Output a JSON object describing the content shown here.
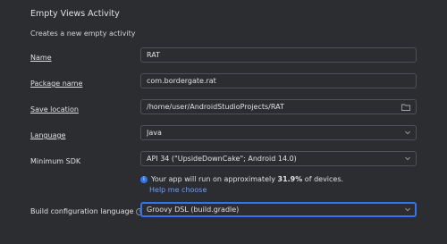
{
  "header": {
    "title": "Empty Views Activity",
    "subtitle": "Creates a new empty activity"
  },
  "form": {
    "name": {
      "label": "Name",
      "value": "RAT"
    },
    "package": {
      "label": "Package name",
      "value": "com.bordergate.rat"
    },
    "save_location": {
      "label": "Save location",
      "value": "/home/user/AndroidStudioProjects/RAT"
    },
    "language": {
      "label": "Language",
      "value": "Java"
    },
    "min_sdk": {
      "label": "Minimum SDK",
      "value": "API 34 (\"UpsideDownCake\"; Android 14.0)"
    },
    "build_config": {
      "label": "Build configuration language",
      "value": "Groovy DSL (build.gradle)"
    }
  },
  "info": {
    "text_before": "Your app will run on approximately ",
    "percent": "31.9%",
    "text_after": " of devices.",
    "help_link": "Help me choose"
  },
  "colors": {
    "background": "#2b2d30",
    "accent": "#3574f0",
    "link": "#6c9fff"
  }
}
